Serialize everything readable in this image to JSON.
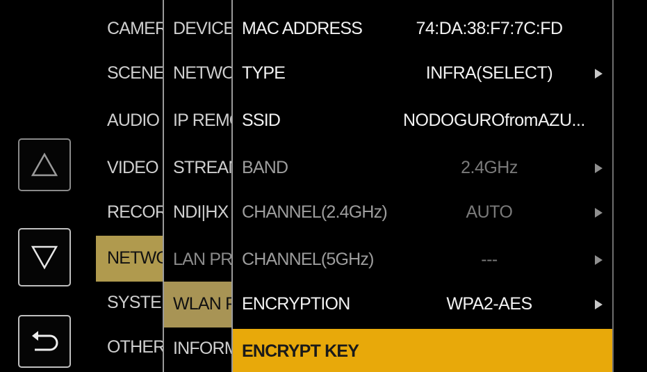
{
  "nav": {
    "up_icon": "triangle-up-icon",
    "down_icon": "triangle-down-icon",
    "back_icon": "return-arrow-icon"
  },
  "menu1": [
    "CAMERA",
    "SCENE",
    "AUDIO",
    "VIDEO OUT",
    "RECORDING",
    "NETWORK",
    "SYSTEM",
    "OTHERS"
  ],
  "menu2": [
    "DEVICE",
    "NETWORK",
    "IP REMOTE",
    "STREAMING",
    "NDI|HX",
    "LAN PROPERTY",
    "WLAN PROPERTY",
    "INFORMATION"
  ],
  "settings": [
    {
      "label": "MAC ADDRESS",
      "value": "74:DA:38:F7:7C:FD"
    },
    {
      "label": "TYPE",
      "value": "INFRA(SELECT)"
    },
    {
      "label": "SSID",
      "value": "NODOGUROfromAZU..."
    },
    {
      "label": "BAND",
      "value": "2.4GHz"
    },
    {
      "label": "CHANNEL(2.4GHz)",
      "value": "AUTO"
    },
    {
      "label": "CHANNEL(5GHz)",
      "value": "---"
    },
    {
      "label": "ENCRYPTION",
      "value": "WPA2-AES"
    },
    {
      "label": "ENCRYPT KEY",
      "value": ""
    }
  ],
  "colors": {
    "highlight": "#e8a90a",
    "selected_column": "#b09a4e"
  }
}
